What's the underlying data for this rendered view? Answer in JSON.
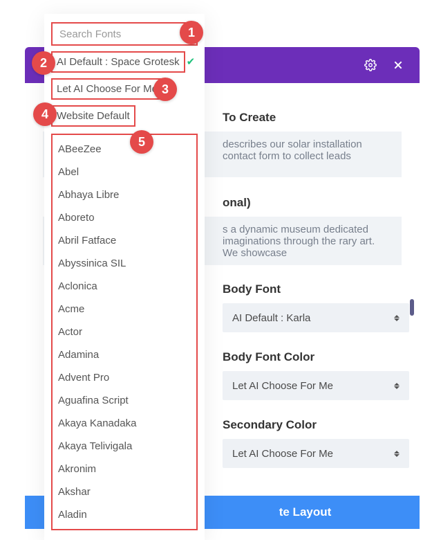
{
  "header": {},
  "sections": {
    "create_label_suffix": "To Create",
    "create_text": "describes our solar installation contact form to collect leads",
    "optional_suffix": "onal)",
    "optional_text": "s a dynamic museum dedicated imaginations through the rary art. We showcase"
  },
  "fields": {
    "body_font": {
      "label": "Body Font",
      "value": "AI Default : Karla"
    },
    "body_font_color": {
      "label": "Body Font Color",
      "value": "Let AI Choose For Me"
    },
    "secondary_color": {
      "label": "Secondary Color",
      "value": "Let AI Choose For Me"
    }
  },
  "button_suffix": "te Layout",
  "dropdown": {
    "search_placeholder": "Search Fonts",
    "ai_default": "AI Default : Space Grotesk",
    "let_ai": "Let AI Choose For Me",
    "website_default": "Website Default",
    "fonts": [
      "ABeeZee",
      "Abel",
      "Abhaya Libre",
      "Aboreto",
      "Abril Fatface",
      "Abyssinica SIL",
      "Aclonica",
      "Acme",
      "Actor",
      "Adamina",
      "Advent Pro",
      "Aguafina Script",
      "Akaya Kanadaka",
      "Akaya Telivigala",
      "Akronim",
      "Akshar",
      "Aladin"
    ]
  },
  "annotations": {
    "1": "1",
    "2": "2",
    "3": "3",
    "4": "4",
    "5": "5"
  }
}
